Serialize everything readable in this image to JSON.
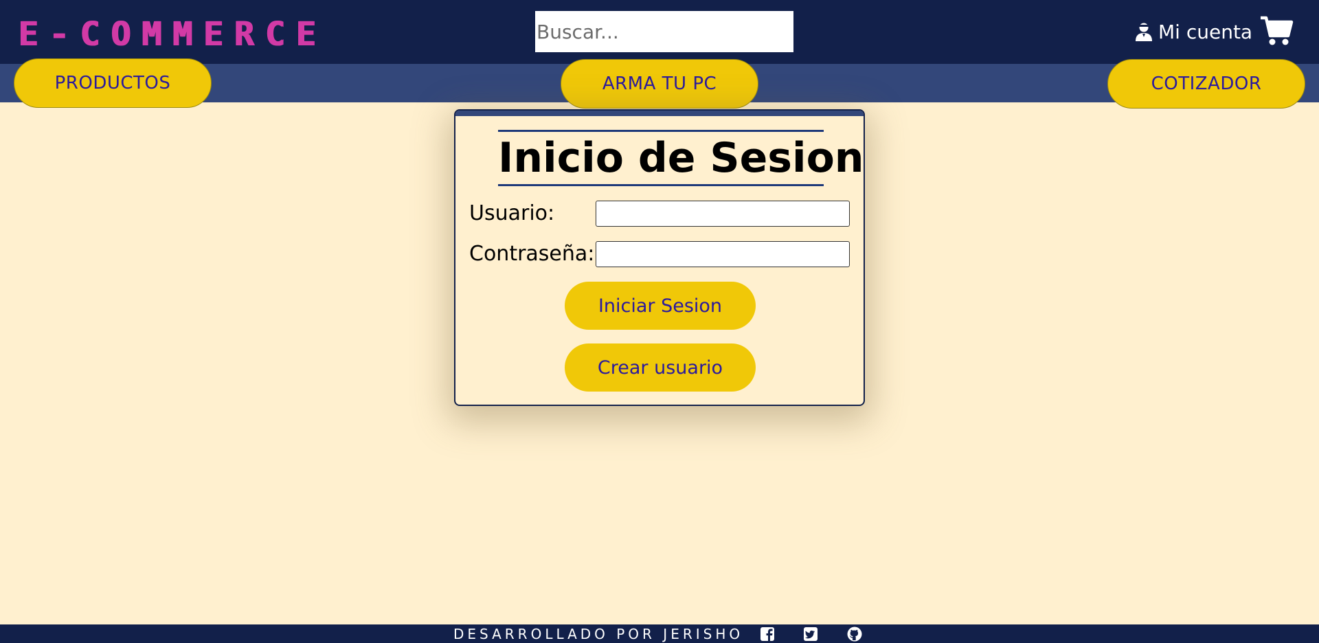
{
  "header": {
    "logo": "E-COMMERCE",
    "search_placeholder": "Buscar...",
    "account_label": "Mi cuenta"
  },
  "nav": {
    "products": "PRODUCTOS",
    "build_pc": "ARMA TU PC",
    "quoter": "COTIZADOR"
  },
  "login": {
    "title": "Inicio de Sesion",
    "user_label": "Usuario:",
    "user_value": "",
    "password_label": "Contraseña:",
    "password_value": "",
    "login_button": "Iniciar Sesion",
    "create_button": "Crear usuario"
  },
  "footer": {
    "credit": "DESARROLLADO POR JERISHO"
  },
  "colors": {
    "header_bg": "#12204a",
    "nav_bg": "#33477a",
    "page_bg": "#fff0cf",
    "accent_yellow": "#f0c808",
    "button_text": "#2a1a9e",
    "logo": "#d23aa6"
  },
  "icons": [
    "user-account-icon",
    "shopping-cart-icon",
    "facebook-icon",
    "twitter-icon",
    "github-icon"
  ]
}
